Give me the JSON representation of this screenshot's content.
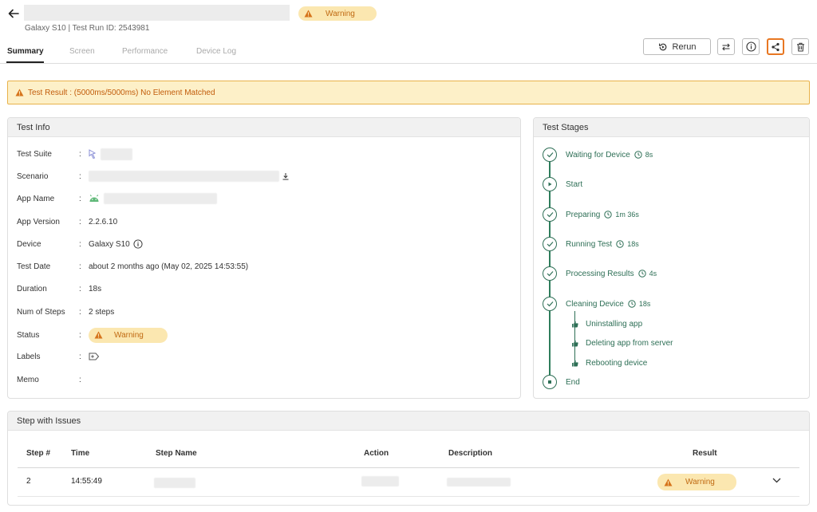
{
  "header": {
    "subtitle": "Galaxy S10 | Test Run ID: 2543981",
    "status_badge": "Warning"
  },
  "tabs": [
    {
      "label": "Summary",
      "active": true
    },
    {
      "label": "Screen",
      "active": false
    },
    {
      "label": "Performance",
      "active": false
    },
    {
      "label": "Device Log",
      "active": false
    }
  ],
  "toolbar": {
    "rerun_label": "Rerun",
    "icons": [
      "compare-icon",
      "info-icon",
      "share-icon",
      "trash-icon"
    ]
  },
  "alert": {
    "text": "Test Result : (5000ms/5000ms) No Element Matched"
  },
  "test_info": {
    "title": "Test Info",
    "rows": [
      {
        "label": "Test Suite",
        "value": ""
      },
      {
        "label": "Scenario",
        "value": ""
      },
      {
        "label": "App Name",
        "value": ""
      },
      {
        "label": "App Version",
        "value": "2.2.6.10"
      },
      {
        "label": "Device",
        "value": "Galaxy S10"
      },
      {
        "label": "Test Date",
        "value": "about 2 months ago (May 02, 2025 14:53:55)"
      },
      {
        "label": "Duration",
        "value": "18s"
      },
      {
        "label": "Num of Steps",
        "value": "2 steps"
      },
      {
        "label": "Status",
        "value": "Warning"
      },
      {
        "label": "Labels",
        "value": ""
      },
      {
        "label": "Memo",
        "value": ""
      }
    ],
    "colon": ":"
  },
  "test_stages": {
    "title": "Test Stages",
    "stages": [
      {
        "label": "Waiting for Device",
        "duration": "8s",
        "icon": "check-icon"
      },
      {
        "label": "Start",
        "duration": "",
        "icon": "play-icon"
      },
      {
        "label": "Preparing",
        "duration": "1m 36s",
        "icon": "check-icon"
      },
      {
        "label": "Running Test",
        "duration": "18s",
        "icon": "check-icon"
      },
      {
        "label": "Processing Results",
        "duration": "4s",
        "icon": "check-icon"
      },
      {
        "label": "Cleaning Device",
        "duration": "18s",
        "icon": "check-icon"
      },
      {
        "label": "End",
        "duration": "",
        "icon": "stop-icon"
      }
    ],
    "substeps": [
      "Uninstalling app",
      "Deleting app from server",
      "Rebooting device"
    ]
  },
  "issues": {
    "title": "Step with Issues",
    "columns": [
      "Step #",
      "Time",
      "Step Name",
      "Action",
      "Description",
      "Result"
    ],
    "rows": [
      {
        "step": "2",
        "time": "14:55:49",
        "step_name": "",
        "action": "",
        "description": "",
        "result": "Warning"
      }
    ]
  },
  "colors": {
    "warning_bg": "#fbe7b0",
    "warning_text": "#c06a12",
    "stage_green": "#2e6f56",
    "share_highlight": "#e87722"
  }
}
